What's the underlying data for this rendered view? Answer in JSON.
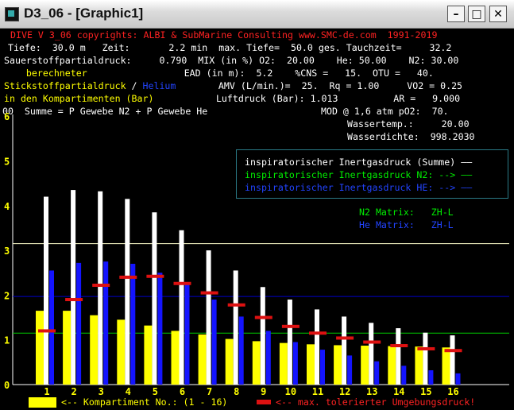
{
  "window": {
    "title": "D3_06 - [Graphic1]",
    "icon": "app-icon",
    "controls": [
      "minimize-icon",
      "maximize-icon",
      "close-icon"
    ]
  },
  "header": {
    "copyright": "DIVE V 3_06 copyrights: ALBI & SubMarine Consulting www.SMC-de.com  1991-2019",
    "line2": " Tiefe:  30.0 m   Zeit:       2.2 min  max. Tiefe=  50.0 ges. Tauchzeit=     32.2",
    "line3_label": "Sauerstoffpartialdruck:",
    "line3_value": "     0.790  MIX (in %) O2:  20.00    He: 50.00    N2: 30.00",
    "line4_left": "    berechneter",
    "line4_right": "               EAD (in m):  5.2    %CNS =   15.  OTU =   40.",
    "line5_n2": "Stickstoffpartialdruck",
    "line5_sep": " / ",
    "line5_he": "Helium",
    "line5_right": "    AMV (L/min.)=  25.  Rq = 1.00     VO2 = 0.25",
    "line6_left": "in den Kompartimenten (Bar)",
    "line6_right": "   Luftdruck (Bar): 1.013          AR =   9.000",
    "line7_left": "00  Summe = P Gewebe N2 + P Gewebe He",
    "line7_right": "MOD @ 1,6 atm pO2:  70.",
    "line8": "Wassertemp.:     20.00",
    "line9": "Wasserdichte:  998.2030"
  },
  "legend": {
    "sum": "inspiratorischer Inertgasdruck (Summe) ——",
    "n2": "inspiratorischer Inertgasdruck N2: --> ——",
    "he": "inspiratorischer Inertgasdruck HE: --> ——"
  },
  "matrix": {
    "n2": "N2 Matrix:   ZH-L",
    "he": "He Matrix:   ZH-L"
  },
  "footer": {
    "compartment_label": "<-- Kompartiment No.: (1 - 16)",
    "tolerated_label": "<-- max. tolerierter Umgebungsdruck!"
  },
  "colors": {
    "sum": "#ffffff",
    "n2": "#ffff00",
    "he": "#1414ff",
    "tolerated": "#dd1111",
    "n2_line": "#00cc00",
    "he_line": "#0000cc",
    "sum_line": "#ffffcc"
  },
  "chart_data": {
    "type": "bar",
    "categories": [
      "1",
      "2",
      "3",
      "4",
      "5",
      "6",
      "7",
      "8",
      "9",
      "10",
      "11",
      "12",
      "13",
      "14",
      "15",
      "16"
    ],
    "ylim": [
      0,
      6
    ],
    "yticks": [
      "0",
      "1",
      "2",
      "3",
      "4",
      "5",
      "6"
    ],
    "series": [
      {
        "key": "n2",
        "values": [
          1.65,
          1.65,
          1.55,
          1.45,
          1.32,
          1.2,
          1.12,
          1.02,
          0.97,
          0.93,
          0.9,
          0.88,
          0.87,
          0.86,
          0.85,
          0.83
        ]
      },
      {
        "key": "sum",
        "values": [
          4.2,
          4.35,
          4.32,
          4.15,
          3.85,
          3.45,
          3.0,
          2.55,
          2.18,
          1.9,
          1.68,
          1.52,
          1.38,
          1.26,
          1.16,
          1.1
        ]
      },
      {
        "key": "he",
        "values": [
          2.55,
          2.72,
          2.75,
          2.7,
          2.5,
          2.25,
          1.9,
          1.52,
          1.2,
          0.95,
          0.78,
          0.65,
          0.52,
          0.42,
          0.32,
          0.25
        ]
      },
      {
        "key": "tolerated",
        "values": [
          1.2,
          1.9,
          2.22,
          2.4,
          2.42,
          2.26,
          2.05,
          1.78,
          1.5,
          1.3,
          1.15,
          1.04,
          0.95,
          0.87,
          0.8,
          0.76
        ]
      }
    ],
    "reference_lines": [
      {
        "key": "sum_line",
        "value": 3.15
      },
      {
        "key": "he_line",
        "value": 1.97
      },
      {
        "key": "n2_line",
        "value": 1.15
      }
    ]
  }
}
